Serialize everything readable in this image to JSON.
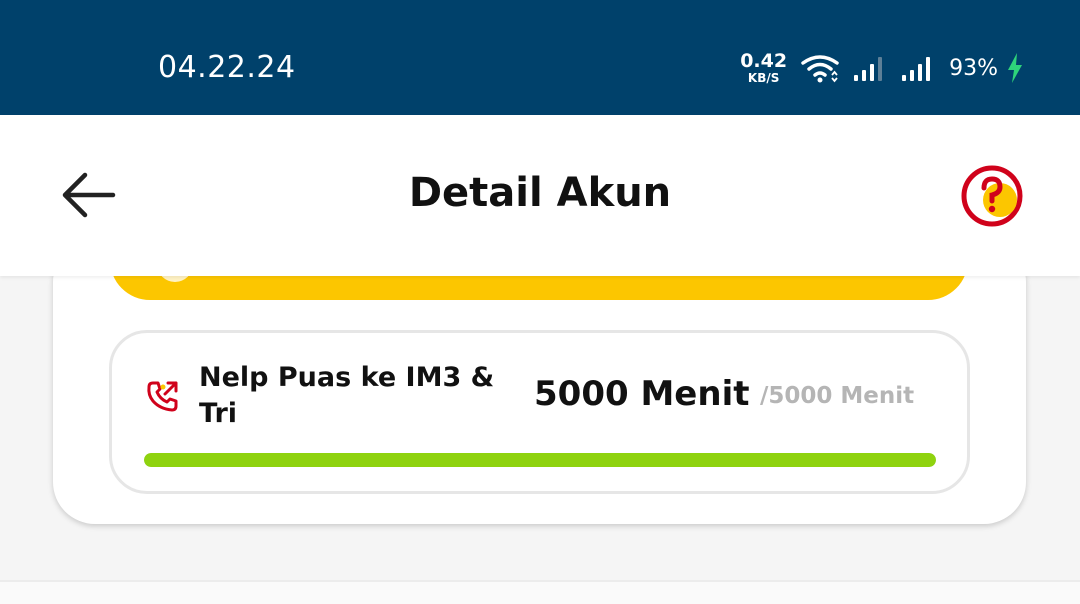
{
  "status_bar": {
    "time": "04.22.24",
    "net_speed_value": "0.42",
    "net_speed_unit": "KB/S",
    "battery": "93%",
    "icons": [
      "wifi-icon",
      "signal-icon",
      "signal-icon",
      "charging-icon"
    ]
  },
  "header": {
    "title": "Detail Akun",
    "back_icon": "arrow-left-icon",
    "help_icon": "help-icon"
  },
  "quota": {
    "icon": "phone-call-icon",
    "name": "Nelp Puas ke IM3 & Tri",
    "remaining": "5000 Menit",
    "total": "/5000 Menit",
    "progress_percent": 100
  },
  "colors": {
    "status_bar": "#00416b",
    "accent_yellow": "#fcc600",
    "accent_red": "#d0021b",
    "progress": "#8fd30f",
    "charging": "#2ed47a"
  }
}
